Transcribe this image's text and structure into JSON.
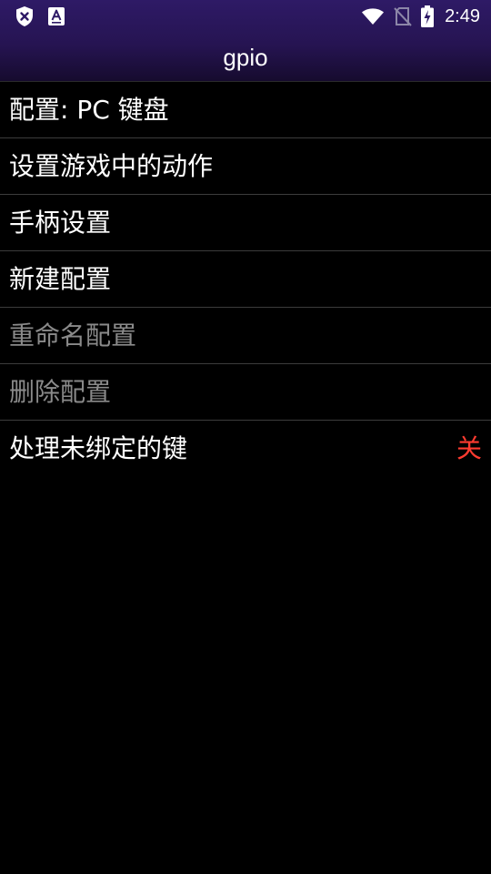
{
  "status_bar": {
    "time": "2:49",
    "icons": [
      "shield-x-icon",
      "text-a-icon",
      "wifi-icon",
      "no-sim-icon",
      "battery-charging-icon"
    ]
  },
  "header": {
    "title": "gpio"
  },
  "menu": {
    "items": [
      {
        "label": "配置: PC 键盘",
        "enabled": true
      },
      {
        "label": "设置游戏中的动作",
        "enabled": true
      },
      {
        "label": "手柄设置",
        "enabled": true
      },
      {
        "label": "新建配置",
        "enabled": true
      },
      {
        "label": "重命名配置",
        "enabled": false
      },
      {
        "label": "删除配置",
        "enabled": false
      },
      {
        "label": "处理未绑定的键",
        "enabled": true,
        "value": "关"
      }
    ]
  },
  "colors": {
    "header_top": "#2e1a66",
    "background": "#000000",
    "toggle_off": "#ff3b30",
    "disabled_text": "#8a8a8a"
  }
}
